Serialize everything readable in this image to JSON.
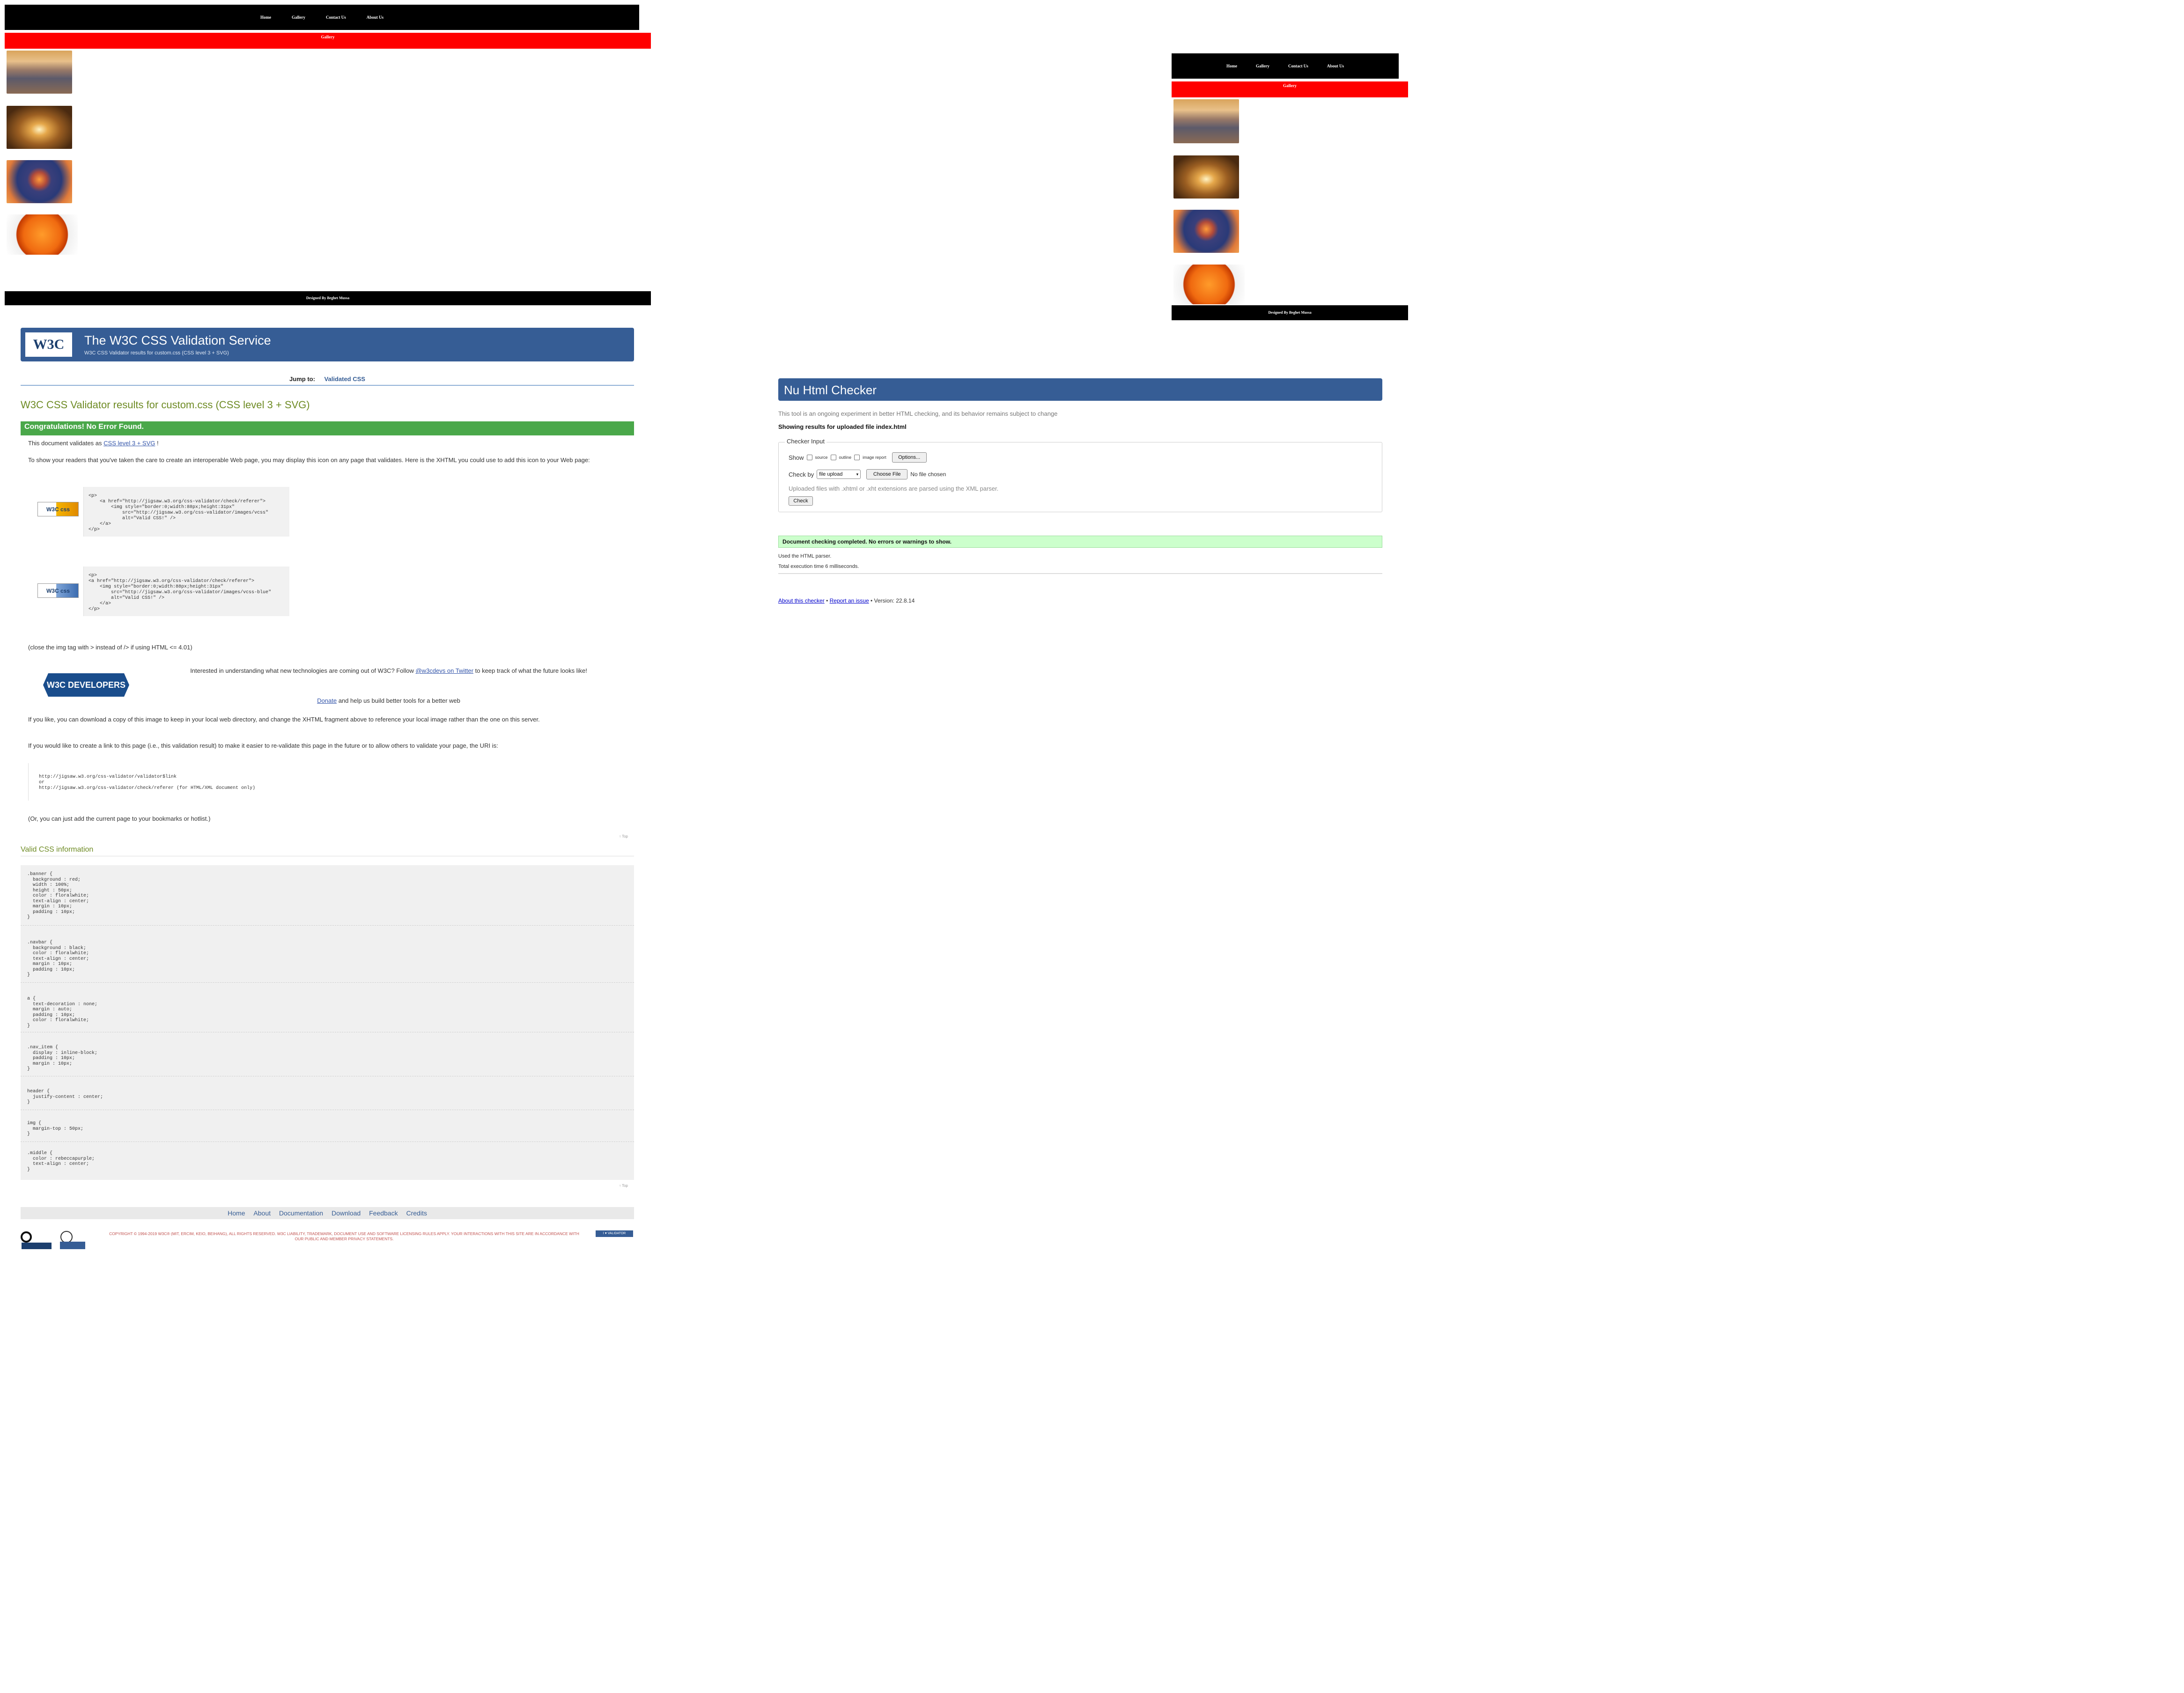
{
  "left_site": {
    "nav": [
      "Home",
      "Gallery",
      "Contact Us",
      "About Us"
    ],
    "banner": "Gallery",
    "footer": "Designed By Beghet Mussa"
  },
  "right_site": {
    "nav": [
      "Home",
      "Gallery",
      "Contact Us",
      "About Us"
    ],
    "banner": "Gallery",
    "footer": "Designed By Beghet Mussa"
  },
  "css_validator": {
    "logo": "W3C",
    "title": "The W3C CSS Validation Service",
    "subtitle": "W3C CSS Validator results for custom.css (CSS level 3 + SVG)",
    "jump_label": "Jump to:",
    "jump_link": "Validated CSS",
    "results_title": "W3C CSS Validator results for custom.css (CSS level 3 + SVG)",
    "congrats": "Congratulations! No Error Found.",
    "validates_prefix": "This document validates as",
    "validates_link": "CSS level 3 + SVG",
    "validates_suffix": "!",
    "show_icon_text": "To show your readers that you've taken the care to create an interoperable Web page, you may display this icon on any page that validates. Here is the XHTML you could use to add this icon to your Web page:",
    "badge1": "W3C css",
    "badge2": "W3C css",
    "code1": "<p>\n    <a href=\"http://jigsaw.w3.org/css-validator/check/referer\">\n        <img style=\"border:0;width:88px;height:31px\"\n            src=\"http://jigsaw.w3.org/css-validator/images/vcss\"\n            alt=\"Valid CSS!\" />\n    </a>\n</p>",
    "code2": "<p>\n<a href=\"http://jigsaw.w3.org/css-validator/check/referer\">\n    <img style=\"border:0;width:88px;height:31px\"\n        src=\"http://jigsaw.w3.org/css-validator/images/vcss-blue\"\n        alt=\"Valid CSS!\" />\n    </a>\n</p>",
    "close_tag_note": "(close the img tag with > instead of /> if using HTML <= 4.01)",
    "dev_badge": "W3C DEVELOPERS",
    "interest_prefix": "Interested in understanding what new technologies are coming out of W3C? Follow",
    "interest_link": "@w3cdevs on Twitter",
    "interest_suffix": "to keep track of what the future looks like!",
    "donate_link": "Donate",
    "donate_suffix": "and help us build better tools for a better web",
    "download_text": "If you like, you can download a copy of this image to keep in your local web directory, and change the XHTML fragment above to reference your local image rather than the one on this server.",
    "link_text": "If you would like to create a link to this page (i.e., this validation result) to make it easier to re-validate this page in the future or to allow others to validate your page, the URI is:",
    "uri_code": "http://jigsaw.w3.org/css-validator/validator$link\nor\nhttp://jigsaw.w3.org/css-validator/check/referer (for HTML/XML document only)",
    "bookmark_text": "(Or, you can just add the current page to your bookmarks or hotlist.)",
    "top_link": "↑ Top",
    "valid_info_title": "Valid CSS information",
    "css_blocks": [
      ".banner {\n  background : red;\n  width : 100%;\n  height : 50px;\n  color : floralwhite;\n  text-align : center;\n  margin : 10px;\n  padding : 10px;\n}",
      ".navbar {\n  background : black;\n  color : floralwhite;\n  text-align : center;\n  margin : 10px;\n  padding : 10px;\n}",
      "a {\n  text-decoration : none;\n  margin : auto;\n  padding : 10px;\n  color : floralwhite;\n}",
      ".nav_item {\n  display : inline-block;\n  padding : 10px;\n  margin : 10px;\n}",
      "header {\n  justify-content : center;\n}",
      "img {\n  margin-top : 50px;\n}",
      ".middle {\n  color : rebeccapurple;\n  text-align : center;\n}"
    ],
    "footer_nav": [
      "Home",
      "About",
      "Documentation",
      "Download",
      "Feedback",
      "Credits"
    ],
    "copyright": "COPYRIGHT © 1994-2019 W3C® (MIT, ERCIM, KEIO, BEIHANG), ALL RIGHTS RESERVED. W3C LIABILITY, TRADEMARK, DOCUMENT USE AND SOFTWARE LICENSING RULES APPLY. YOUR INTERACTIONS WITH THIS SITE ARE IN ACCORDANCE WITH OUR PUBLIC AND MEMBER PRIVACY STATEMENTS.",
    "iso_label": "I ♥ VALIDATOR"
  },
  "nu_checker": {
    "title": "Nu Html Checker",
    "intro": "This tool is an ongoing experiment in better HTML checking, and its behavior remains subject to change",
    "showing": "Showing results for uploaded file index.html",
    "legend": "Checker Input",
    "show_label": "Show",
    "show_options": [
      "source",
      "outline",
      "image report"
    ],
    "options_button": "Options...",
    "check_by_label": "Check by",
    "check_by_value": "file upload",
    "choose_file_button": "Choose File",
    "no_file": "No file chosen",
    "upload_note": "Uploaded files with .xhtml or .xht extensions are parsed using the XML parser.",
    "check_button": "Check",
    "success": "Document checking completed. No errors or warnings to show.",
    "used_parser": "Used the HTML parser.",
    "exec_time": "Total execution time 6 milliseconds.",
    "about_link": "About this checker",
    "sep": "•",
    "report_link": "Report an issue",
    "version": "• Version: 22.8.14"
  },
  "colors": {
    "w3c_blue": "#365d95",
    "congrats_green": "#4aa84a",
    "title_olive": "#6e8b24",
    "banner_red": "#ff0000",
    "success_green": "#ccffcc"
  }
}
